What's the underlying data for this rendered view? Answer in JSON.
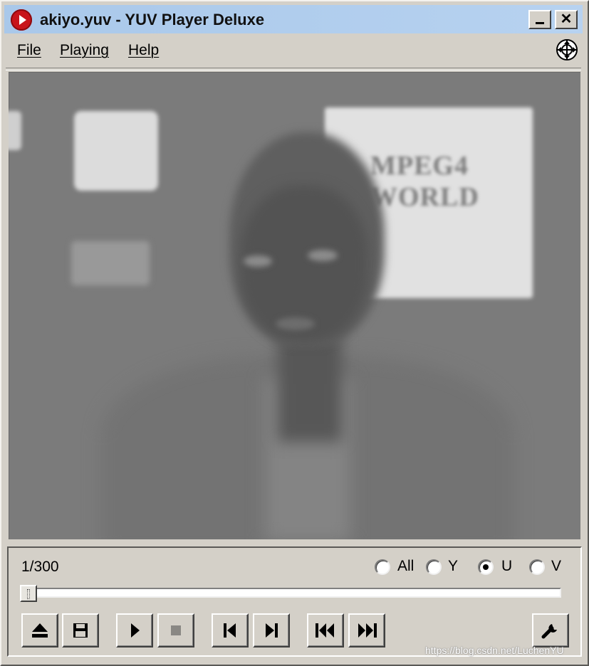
{
  "window": {
    "title": "akiyo.yuv - YUV Player Deluxe",
    "minimize_glyph": "_",
    "close_glyph": "✕"
  },
  "menubar": {
    "items": [
      {
        "label": "File"
      },
      {
        "label": "Playing"
      },
      {
        "label": "Help"
      }
    ],
    "right_icon": "globe-target-icon"
  },
  "video": {
    "description_visible_text": [
      "MPEG4",
      "WORLD"
    ]
  },
  "controls": {
    "frame_counter": "1/300",
    "channels": {
      "options": [
        {
          "label": "All",
          "checked": false
        },
        {
          "label": "Y",
          "checked": false
        },
        {
          "label": "U",
          "checked": true
        },
        {
          "label": "V",
          "checked": false
        }
      ]
    },
    "seek_progress": 0.0,
    "buttons": [
      {
        "icon": "eject-icon"
      },
      {
        "icon": "save-icon"
      },
      {
        "icon": "play-icon"
      },
      {
        "icon": "stop-icon",
        "disabled": true
      },
      {
        "icon": "step-back-icon"
      },
      {
        "icon": "step-forward-icon"
      },
      {
        "icon": "skip-to-start-icon"
      },
      {
        "icon": "skip-to-end-icon"
      },
      {
        "icon": "wrench-icon"
      }
    ]
  },
  "watermark": "https://blog.csdn.net/LuchenYU"
}
